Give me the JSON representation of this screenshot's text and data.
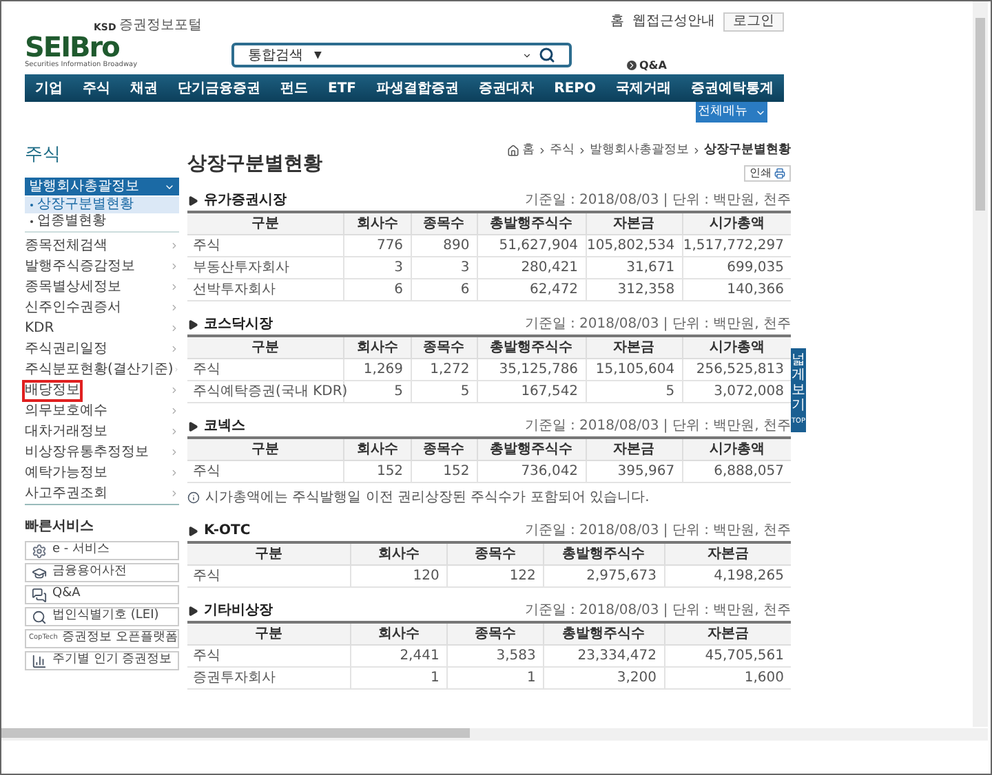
{
  "header": {
    "utility_links": [
      "홈",
      "웹접근성안내"
    ],
    "login_button": "로그인",
    "logo": {
      "text": "SEIBro",
      "badge": "KSD",
      "badge_sub": "증권정보포털",
      "tagline": "Securities Information Broadway"
    },
    "search": {
      "category": "통합검색",
      "arrow": "▼"
    },
    "qa_link": "Q&A"
  },
  "nav": {
    "items": [
      "기업",
      "주식",
      "채권",
      "단기금융증권",
      "펀드",
      "ETF",
      "파생결합증권",
      "증권대차",
      "REPO",
      "국제거래",
      "증권예탁통계"
    ],
    "all_menu_button": "전체메뉴"
  },
  "sidebar": {
    "title": "주식",
    "section": {
      "label": "발행회사총괄정보",
      "expanded": true,
      "children": [
        {
          "label": "상장구분별현황",
          "selected": true
        },
        {
          "label": "업종별현황",
          "selected": false
        }
      ]
    },
    "items": [
      {
        "label": "종목전체검색",
        "highlighted": false
      },
      {
        "label": "발행주식증감정보",
        "highlighted": false
      },
      {
        "label": "종목별상세정보",
        "highlighted": false
      },
      {
        "label": "신주인수권증서",
        "highlighted": false
      },
      {
        "label": "KDR",
        "highlighted": false
      },
      {
        "label": "주식권리일정",
        "highlighted": false
      },
      {
        "label": "주식분포현황(결산기준)",
        "highlighted": false
      },
      {
        "label": "배당정보",
        "highlighted": true
      },
      {
        "label": "의무보호예수",
        "highlighted": false
      },
      {
        "label": "대차거래정보",
        "highlighted": false
      },
      {
        "label": "비상장유통추정정보",
        "highlighted": false
      },
      {
        "label": "예탁가능정보",
        "highlighted": false
      },
      {
        "label": "사고주권조회",
        "highlighted": false
      }
    ],
    "quick_services": {
      "title": "빠른서비스",
      "items": [
        {
          "label": "e - 서비스",
          "kind": "gear"
        },
        {
          "label": "금융용어사전",
          "kind": "hat"
        },
        {
          "label": "Q&A",
          "kind": "chat"
        },
        {
          "label": "법인식별기호 (LEI)",
          "kind": "magnifier"
        },
        {
          "label": "증권정보 오픈플랫폼",
          "kind": "logo",
          "icon_text": "CopTech"
        },
        {
          "label": "주기별 인기 증권정보",
          "kind": "chart"
        }
      ]
    }
  },
  "main": {
    "title": "상장구분별현황",
    "breadcrumb": [
      "홈",
      "주식",
      "발행회사총괄정보",
      "상장구분별현황"
    ],
    "print_button": "인쇄",
    "sections": [
      {
        "title": "유가증권시장",
        "meta": "기준일 : 2018/08/03 | 단위 : 백만원, 천주",
        "columns": [
          "구분",
          "회사수",
          "종목수",
          "총발행주식수",
          "자본금",
          "시가총액"
        ],
        "rows": [
          [
            "주식",
            "776",
            "890",
            "51,627,904",
            "105,802,534",
            "1,517,772,297"
          ],
          [
            "부동산투자회사",
            "3",
            "3",
            "280,421",
            "31,671",
            "699,035"
          ],
          [
            "선박투자회사",
            "6",
            "6",
            "62,472",
            "312,358",
            "140,366"
          ]
        ]
      },
      {
        "title": "코스닥시장",
        "meta": "기준일 : 2018/08/03 | 단위 : 백만원, 천주",
        "columns": [
          "구분",
          "회사수",
          "종목수",
          "총발행주식수",
          "자본금",
          "시가총액"
        ],
        "rows": [
          [
            "주식",
            "1,269",
            "1,272",
            "35,125,786",
            "15,105,604",
            "256,525,813"
          ],
          [
            "주식예탁증권(국내 KDR)",
            "5",
            "5",
            "167,542",
            "5",
            "3,072,008"
          ]
        ]
      },
      {
        "title": "코넥스",
        "meta": "기준일 : 2018/08/03 | 단위 : 백만원, 천주",
        "columns": [
          "구분",
          "회사수",
          "종목수",
          "총발행주식수",
          "자본금",
          "시가총액"
        ],
        "rows": [
          [
            "주식",
            "152",
            "152",
            "736,042",
            "395,967",
            "6,888,057"
          ]
        ],
        "note": "시가총액에는 주식발행일 이전 권리상장된 주식수가 포함되어 있습니다."
      },
      {
        "title": "K-OTC",
        "meta": "기준일 : 2018/08/03 | 단위 : 백만원, 천주",
        "columns": [
          "구분",
          "회사수",
          "종목수",
          "총발행주식수",
          "자본금"
        ],
        "rows": [
          [
            "주식",
            "120",
            "122",
            "2,975,673",
            "4,198,265"
          ]
        ]
      },
      {
        "title": "기타비상장",
        "meta": "기준일 : 2018/08/03 | 단위 : 백만원, 천주",
        "columns": [
          "구분",
          "회사수",
          "종목수",
          "총발행주식수",
          "자본금"
        ],
        "rows": [
          [
            "주식",
            "2,441",
            "3,583",
            "23,334,472",
            "45,705,561"
          ],
          [
            "증권투자회사",
            "1",
            "1",
            "3,200",
            "1,600"
          ]
        ]
      }
    ]
  },
  "side_tab": {
    "label": "넓게보기",
    "top": "TOP"
  }
}
